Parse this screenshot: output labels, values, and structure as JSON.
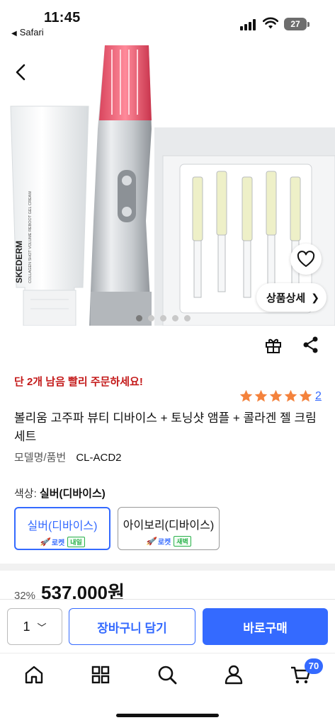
{
  "status_bar": {
    "time": "11:45",
    "back_app": "Safari",
    "battery": "27"
  },
  "hero": {
    "detail_label": "상품상세",
    "slide_count": 5,
    "active_slide": 1,
    "tube_text": "SKEDERM",
    "tube_subtext": "COLLAGEN SHOT VOLUME REBOOT GEL CREAM"
  },
  "product": {
    "urgency": "단 2개 남음 빨리 주문하세요!",
    "rating": 5,
    "rating_count": "2",
    "title": "볼리움 고주파 뷰티 디바이스 + 토닝샷 앰플 + 콜라겐 젤 크림 세트",
    "model_label": "모델명/품번",
    "model_value": "CL-ACD2",
    "color_label": "색상:",
    "color_value": "실버(디바이스)",
    "options": [
      {
        "name": "실버(디바이스)",
        "rocket": "로켓",
        "badge": "내일",
        "selected": true
      },
      {
        "name": "아이보리(디바이스)",
        "rocket": "로켓",
        "badge": "새벽",
        "selected": false
      }
    ],
    "discount": "32%",
    "price": "537,000원"
  },
  "purchase_bar": {
    "quantity": "1",
    "cart_label": "장바구니 담기",
    "buy_label": "바로구매"
  },
  "bottom_nav": {
    "items": [
      "home-icon",
      "category-icon",
      "search-icon",
      "user-icon",
      "cart-icon"
    ],
    "cart_count": "70"
  },
  "colors": {
    "accent": "#346aff",
    "urgency": "#c41a1a",
    "star": "#f4823c"
  }
}
